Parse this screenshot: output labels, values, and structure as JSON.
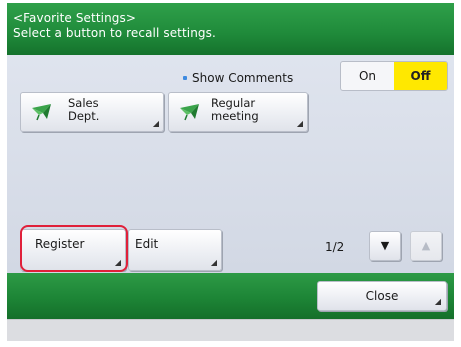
{
  "header": {
    "title": "<Favorite Settings>",
    "subtitle": "Select a button to recall settings."
  },
  "show_comments": {
    "label": "Show Comments",
    "options": [
      "On",
      "Off"
    ],
    "selected": "Off",
    "selected_color": "#ffe800"
  },
  "favorites": [
    {
      "label_line1": "Sales",
      "label_line2": "Dept.",
      "icon": "green-flag-icon"
    },
    {
      "label_line1": "Regular",
      "label_line2": "meeting",
      "icon": "green-flag-icon"
    }
  ],
  "actions": {
    "register_label": "Register",
    "edit_label": "Edit"
  },
  "pagination": {
    "page_text": "1/2"
  },
  "footer": {
    "close_label": "Close"
  },
  "colors": {
    "accent_green": "#1f8a3a",
    "highlight_red": "#e0203a"
  }
}
